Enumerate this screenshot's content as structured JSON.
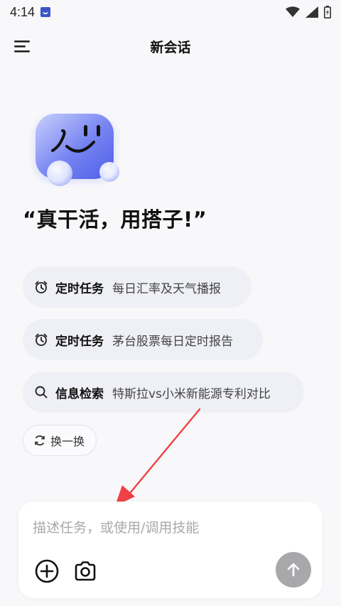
{
  "status_bar": {
    "time": "4:14",
    "app_icon": "app-notification-icon",
    "icons": [
      "wifi-icon",
      "signal-icon",
      "battery-icon"
    ]
  },
  "header": {
    "title": "新会话",
    "menu_icon": "menu-icon"
  },
  "hero": {
    "mascot": "mascot-icon",
    "slogan": "“真干活，用搭子!”"
  },
  "suggestions": [
    {
      "icon": "alarm-clock-icon",
      "category": "定时任务",
      "text": "每日汇率及天气播报"
    },
    {
      "icon": "alarm-clock-icon",
      "category": "定时任务",
      "text": "茅台股票每日定时报告"
    },
    {
      "icon": "search-icon",
      "category": "信息检索",
      "text": "特斯拉vs小米新能源专利对比"
    }
  ],
  "refresh": {
    "icon": "refresh-icon",
    "label": "换一换"
  },
  "composer": {
    "placeholder": "描述任务，或使用/调用技能",
    "value": "",
    "add_icon": "plus-circle-icon",
    "camera_icon": "camera-icon",
    "send_icon": "arrow-up-icon"
  },
  "colors": {
    "background": "#f8f8fa",
    "chip_bg": "#eff0f6",
    "send_button": "#a8a8ab",
    "annotation_arrow": "#ef4146",
    "mascot_blue": "#5a6df0"
  }
}
